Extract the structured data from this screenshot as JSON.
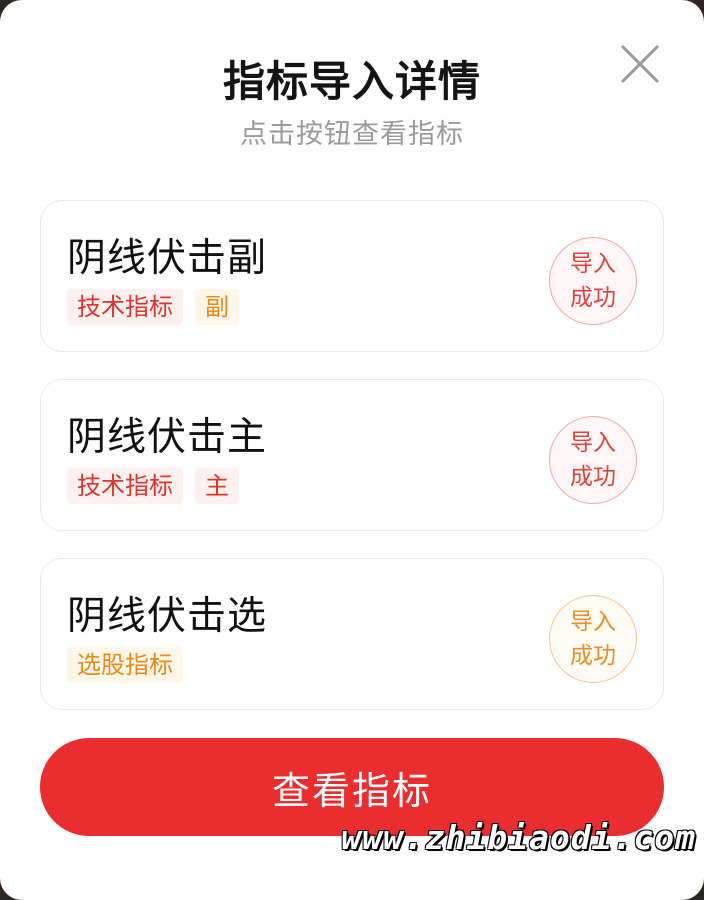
{
  "modal": {
    "title": "指标导入详情",
    "subtitle": "点击按钮查看指标",
    "close_icon": "close-icon"
  },
  "indicators": [
    {
      "name": "阴线伏击副",
      "tags": [
        {
          "label": "技术指标",
          "color": "#e0342f"
        },
        {
          "label": "副",
          "color": "#e98a1a"
        }
      ],
      "status_line1": "导入",
      "status_line2": "成功",
      "status_color": "#e0423d"
    },
    {
      "name": "阴线伏击主",
      "tags": [
        {
          "label": "技术指标",
          "color": "#e0342f"
        },
        {
          "label": "主",
          "color": "#e0342f"
        }
      ],
      "status_line1": "导入",
      "status_line2": "成功",
      "status_color": "#e0423d"
    },
    {
      "name": "阴线伏击选",
      "tags": [
        {
          "label": "选股指标",
          "color": "#e98a1a"
        }
      ],
      "status_line1": "导入",
      "status_line2": "成功",
      "status_color": "#eb8e22"
    }
  ],
  "actions": {
    "view_label": "查看指标",
    "button_color": "#ea2d2f"
  },
  "watermark": "www.zhibiaodi.com"
}
